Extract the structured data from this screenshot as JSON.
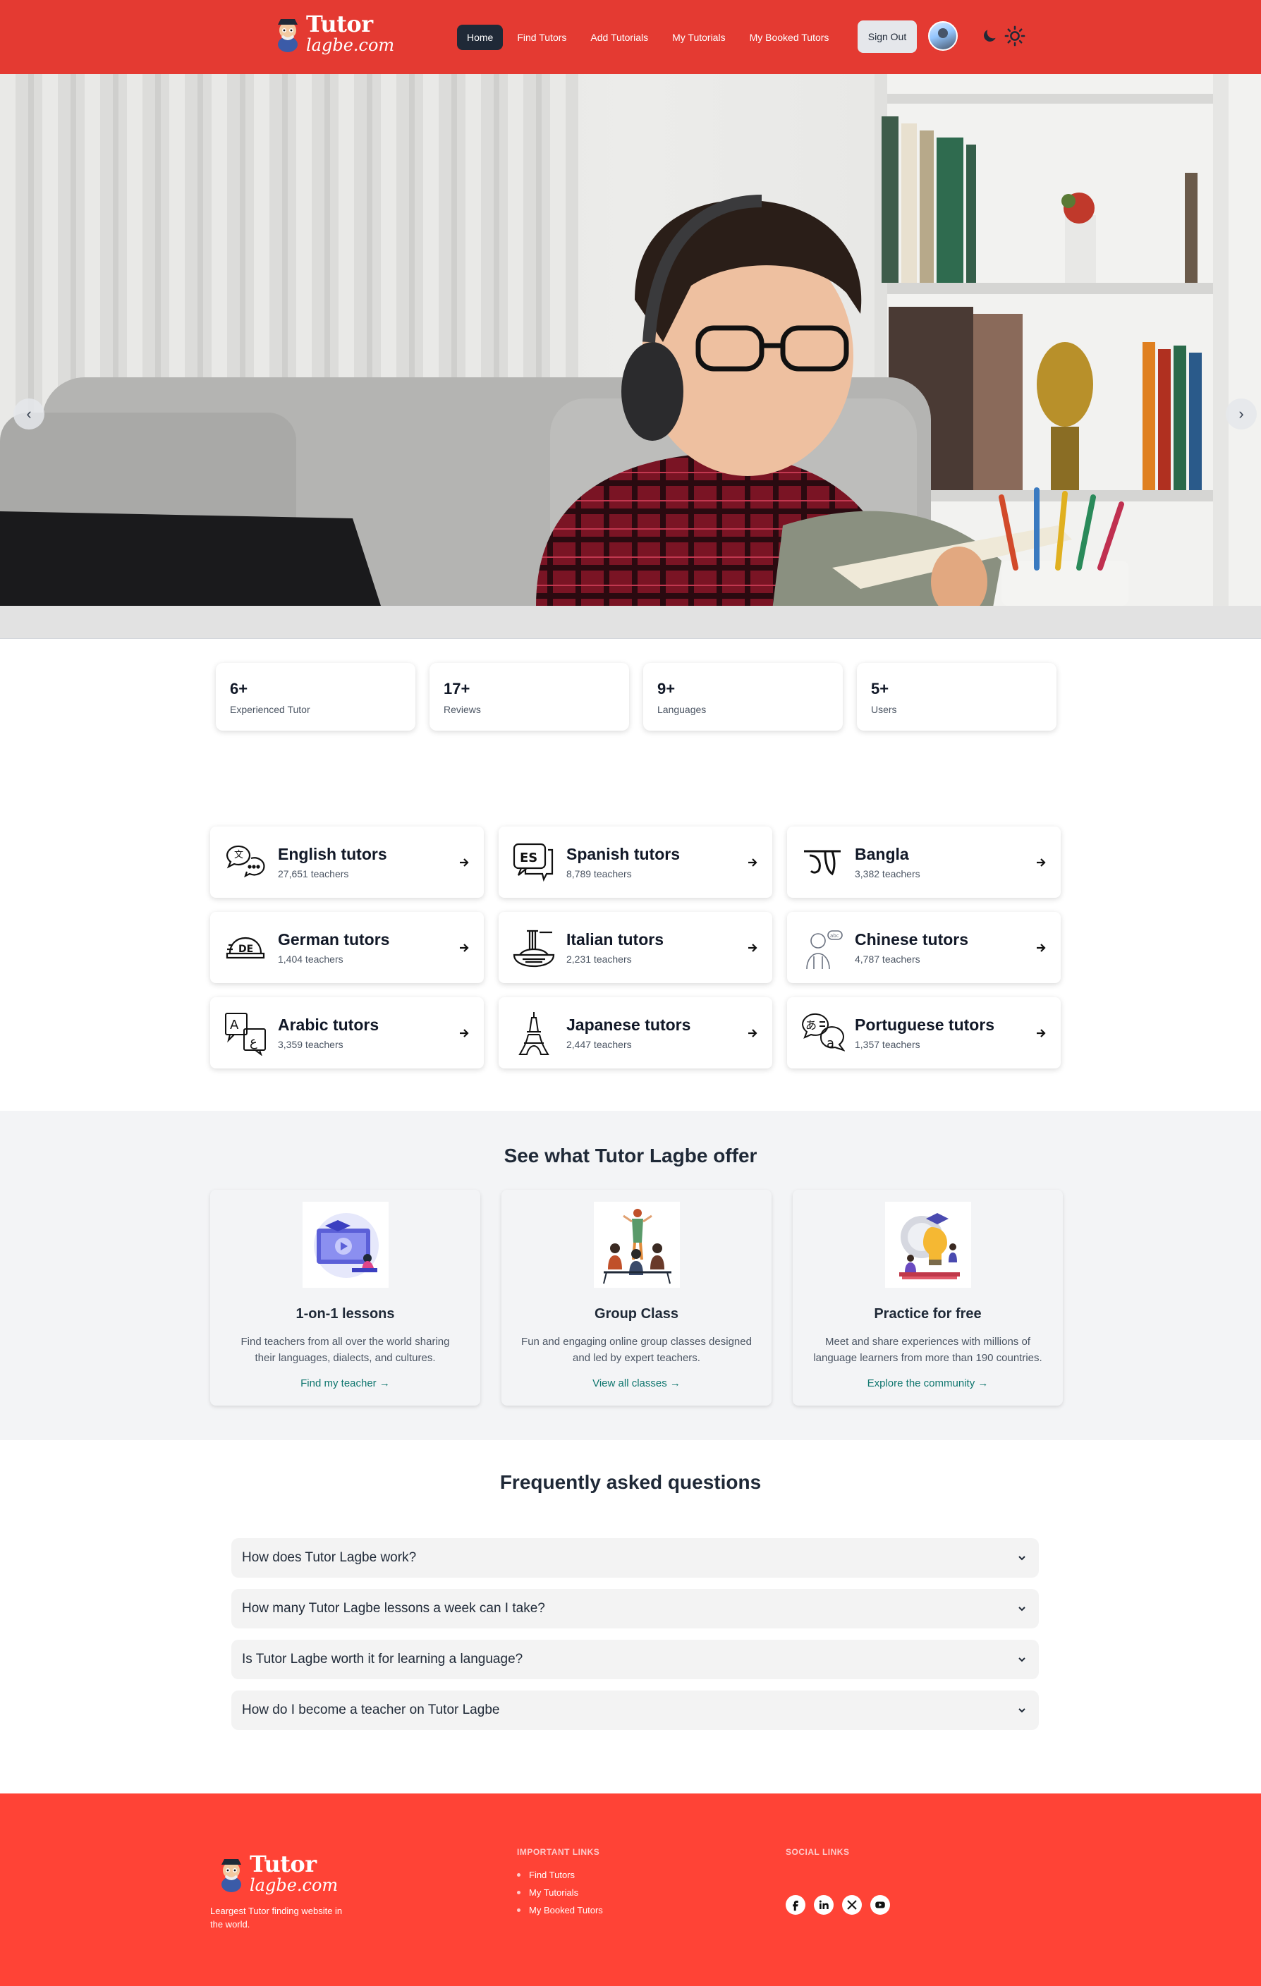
{
  "nav": {
    "logo_line1": "Tutor",
    "logo_line2": "lagbe.com",
    "links": [
      "Home",
      "Find Tutors",
      "Add Tutorials",
      "My Tutorials",
      "My Booked Tutors"
    ],
    "sign_out": "Sign Out"
  },
  "hero": {
    "prev": "‹",
    "next": "›"
  },
  "stats": [
    {
      "value": "6+",
      "label": "Experienced Tutor"
    },
    {
      "value": "17+",
      "label": "Reviews"
    },
    {
      "value": "9+",
      "label": "Languages"
    },
    {
      "value": "5+",
      "label": "Users"
    }
  ],
  "languages": [
    {
      "name": "English tutors",
      "count": "27,651 teachers",
      "icon": "speech-bubbles-icon"
    },
    {
      "name": "Spanish tutors",
      "count": "8,789 teachers",
      "icon": "es-speech-icon"
    },
    {
      "name": "Bangla",
      "count": "3,382 teachers",
      "icon": "bangla-script-icon"
    },
    {
      "name": "German tutors",
      "count": "1,404 teachers",
      "icon": "de-helmet-icon"
    },
    {
      "name": "Italian tutors",
      "count": "2,231 teachers",
      "icon": "pasta-icon"
    },
    {
      "name": "Chinese tutors",
      "count": "4,787 teachers",
      "icon": "person-speaking-icon"
    },
    {
      "name": "Arabic tutors",
      "count": "3,359 teachers",
      "icon": "translate-icon"
    },
    {
      "name": "Japanese tutors",
      "count": "2,447 teachers",
      "icon": "eiffel-tower-icon"
    },
    {
      "name": "Portuguese tutors",
      "count": "1,357 teachers",
      "icon": "kana-speech-icon"
    }
  ],
  "offer": {
    "title": "See what Tutor Lagbe offer",
    "cards": [
      {
        "title": "1-on-1 lessons",
        "desc": "Find teachers from all over the world sharing their languages, dialects, and cultures.",
        "link": "Find my teacher →"
      },
      {
        "title": "Group Class",
        "desc": "Fun and engaging online group classes designed and led by expert teachers.",
        "link": "View all classes →"
      },
      {
        "title": "Practice for free",
        "desc": "Meet and share experiences with millions of language learners from more than 190 countries.",
        "link": "Explore the community →"
      }
    ]
  },
  "faq": {
    "title": "Frequently asked questions",
    "items": [
      "How does Tutor Lagbe work?",
      "How many Tutor Lagbe lessons a week can I take?",
      "Is Tutor Lagbe worth it for learning a language?",
      "How do I become a teacher on Tutor Lagbe"
    ]
  },
  "footer": {
    "logo_line1": "Tutor",
    "logo_line2": "lagbe.com",
    "tagline": "Leargest Tutor finding website in the world.",
    "important_title": "IMPORTANT LINKS",
    "important_links": [
      "Find Tutors",
      "My Tutorials",
      "My Booked Tutors"
    ],
    "social_title": "SOCIAL LINKS",
    "social": [
      "facebook-icon",
      "linkedin-icon",
      "x-icon",
      "youtube-icon"
    ]
  },
  "colors": {
    "nav_bg": "#e43a32",
    "footer_bg": "#ff4336",
    "accent_link": "#0f766e"
  }
}
